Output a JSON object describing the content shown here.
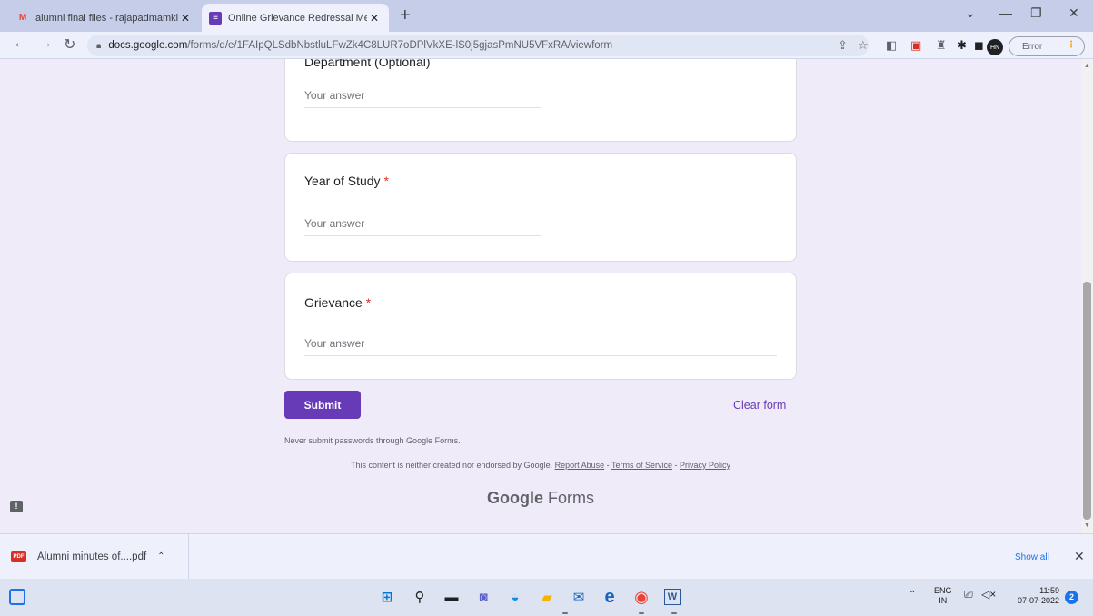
{
  "browser": {
    "tabs": [
      {
        "favicon": "gmail-icon",
        "title": "alumni final files - rajapadmamki",
        "active": false
      },
      {
        "favicon": "google-forms-icon",
        "title": "Online Grievance Redressal Mecl",
        "active": true
      }
    ],
    "new_tab_label": "+",
    "url_host": "docs.google.com",
    "url_path": "/forms/d/e/1FAIpQLSdbNbstluLFwZk4C8LUR7oDPlVkXE-lS0j5gjasPmNU5VFxRA/viewform",
    "error_label": "Error"
  },
  "form": {
    "partial_question_title": "Department (Optional)",
    "questions": [
      {
        "title": "Year of Study",
        "required": "*",
        "placeholder": "Your answer"
      },
      {
        "title": "Grievance",
        "required": "*",
        "placeholder": "Your answer"
      }
    ],
    "department_placeholder": "Your answer",
    "submit_label": "Submit",
    "clear_label": "Clear form",
    "password_warning": "Never submit passwords through Google Forms.",
    "disclaimer_text": "This content is neither created nor endorsed by Google.",
    "report_abuse": "Report Abuse",
    "terms": "Terms of Service",
    "privacy": "Privacy Policy",
    "sep": " - ",
    "brand_google": "Google",
    "brand_forms": "Forms"
  },
  "downloads": {
    "file_name": "Alumni minutes of....pdf",
    "file_icon_text": "PDF",
    "show_all": "Show all",
    "close": "✕"
  },
  "taskbar": {
    "language": "ENG",
    "region": "IN",
    "time": "11:59",
    "date": "07-07-2022",
    "notification_count": "2"
  }
}
